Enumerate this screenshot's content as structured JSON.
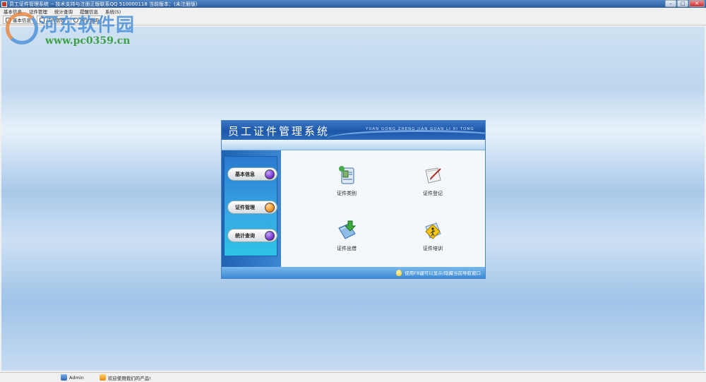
{
  "window": {
    "title": "员工证件管理系统 -- 技术支持与注册正版联系QQ 510000118   当前版本：(未注册版)",
    "buttons": {
      "minimize": "–",
      "maximize": "□",
      "close": "✕"
    }
  },
  "menu": [
    "基本信息",
    "证件管理",
    "统计查询",
    "提醒信息",
    "系统(S)"
  ],
  "toolbar": [
    {
      "label": "基本信息",
      "icon": "book-icon"
    },
    {
      "label": "证件管理",
      "icon": "card-icon"
    },
    {
      "label": "统计查询",
      "icon": "chart-icon"
    }
  ],
  "watermark": {
    "title": "河东软件园",
    "url": "www.pc0359.cn"
  },
  "panel": {
    "title": "员工证件管理系统",
    "pinyin": "YUAN GONG ZHENG JIAN GUAN LI XI TONG",
    "nav": [
      {
        "label": "基本信息",
        "color": "#6a2bc9"
      },
      {
        "label": "证件管理",
        "color": "#f08a14"
      },
      {
        "label": "统计查询",
        "color": "#6a2bc9"
      }
    ],
    "tiles": [
      {
        "label": "证件类别",
        "icon": "certificate-category-icon"
      },
      {
        "label": "证件登记",
        "icon": "certificate-register-icon"
      },
      {
        "label": "证件出借",
        "icon": "certificate-lend-icon"
      },
      {
        "label": "证件培训",
        "icon": "certificate-training-icon"
      }
    ],
    "footer_tip": "使用F8键可以显示/隐藏当前导航窗口"
  },
  "status": {
    "user": "Admin",
    "welcome": "欢迎使用我们的产品!"
  },
  "colors": {
    "accent": "#1e56a8",
    "desktop": "#bdd6ee"
  }
}
